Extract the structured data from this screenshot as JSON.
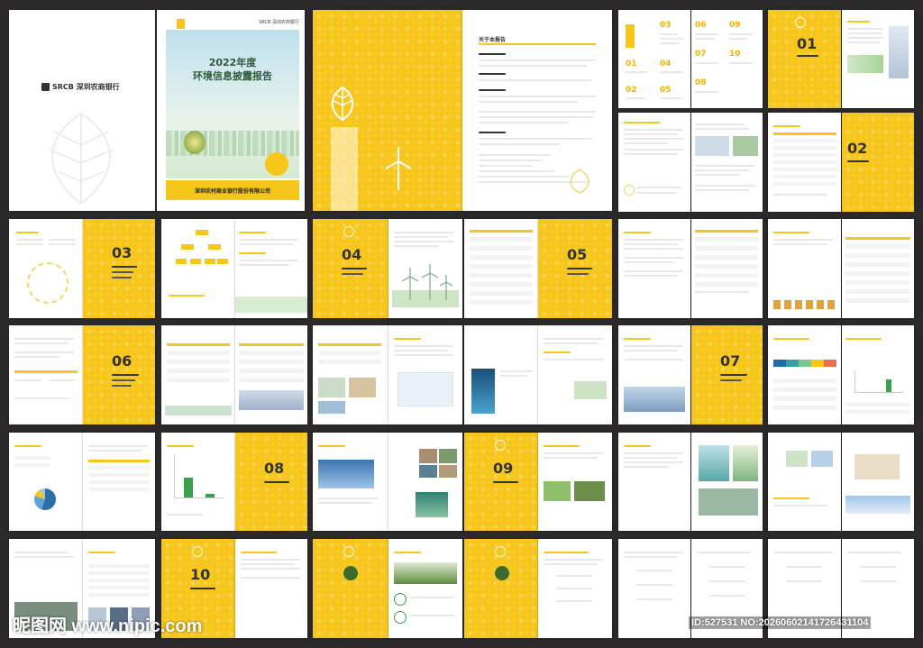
{
  "brand": {
    "logo_text": "SRCB 深圳农商银行"
  },
  "cover": {
    "year_title": "2022年度",
    "report_title": "环境信息披露报告",
    "company": "深圳农村商业银行股份有限公司"
  },
  "about_page": {
    "heading": "关于本报告"
  },
  "sections": [
    {
      "num": "01"
    },
    {
      "num": "02"
    },
    {
      "num": "03"
    },
    {
      "num": "04"
    },
    {
      "num": "05"
    },
    {
      "num": "06"
    },
    {
      "num": "07"
    },
    {
      "num": "08"
    },
    {
      "num": "09"
    },
    {
      "num": "10"
    }
  ],
  "contents_numbers": [
    "03",
    "06",
    "09",
    "01",
    "04",
    "07",
    "10",
    "02",
    "05",
    "08"
  ],
  "watermark": {
    "left": "昵图网 www.nipic.com",
    "right": "ID:527531 NO:20260602141726431104"
  },
  "colors": {
    "accent": "#f7c61a",
    "background": "#2b2929",
    "page": "#ffffff"
  }
}
